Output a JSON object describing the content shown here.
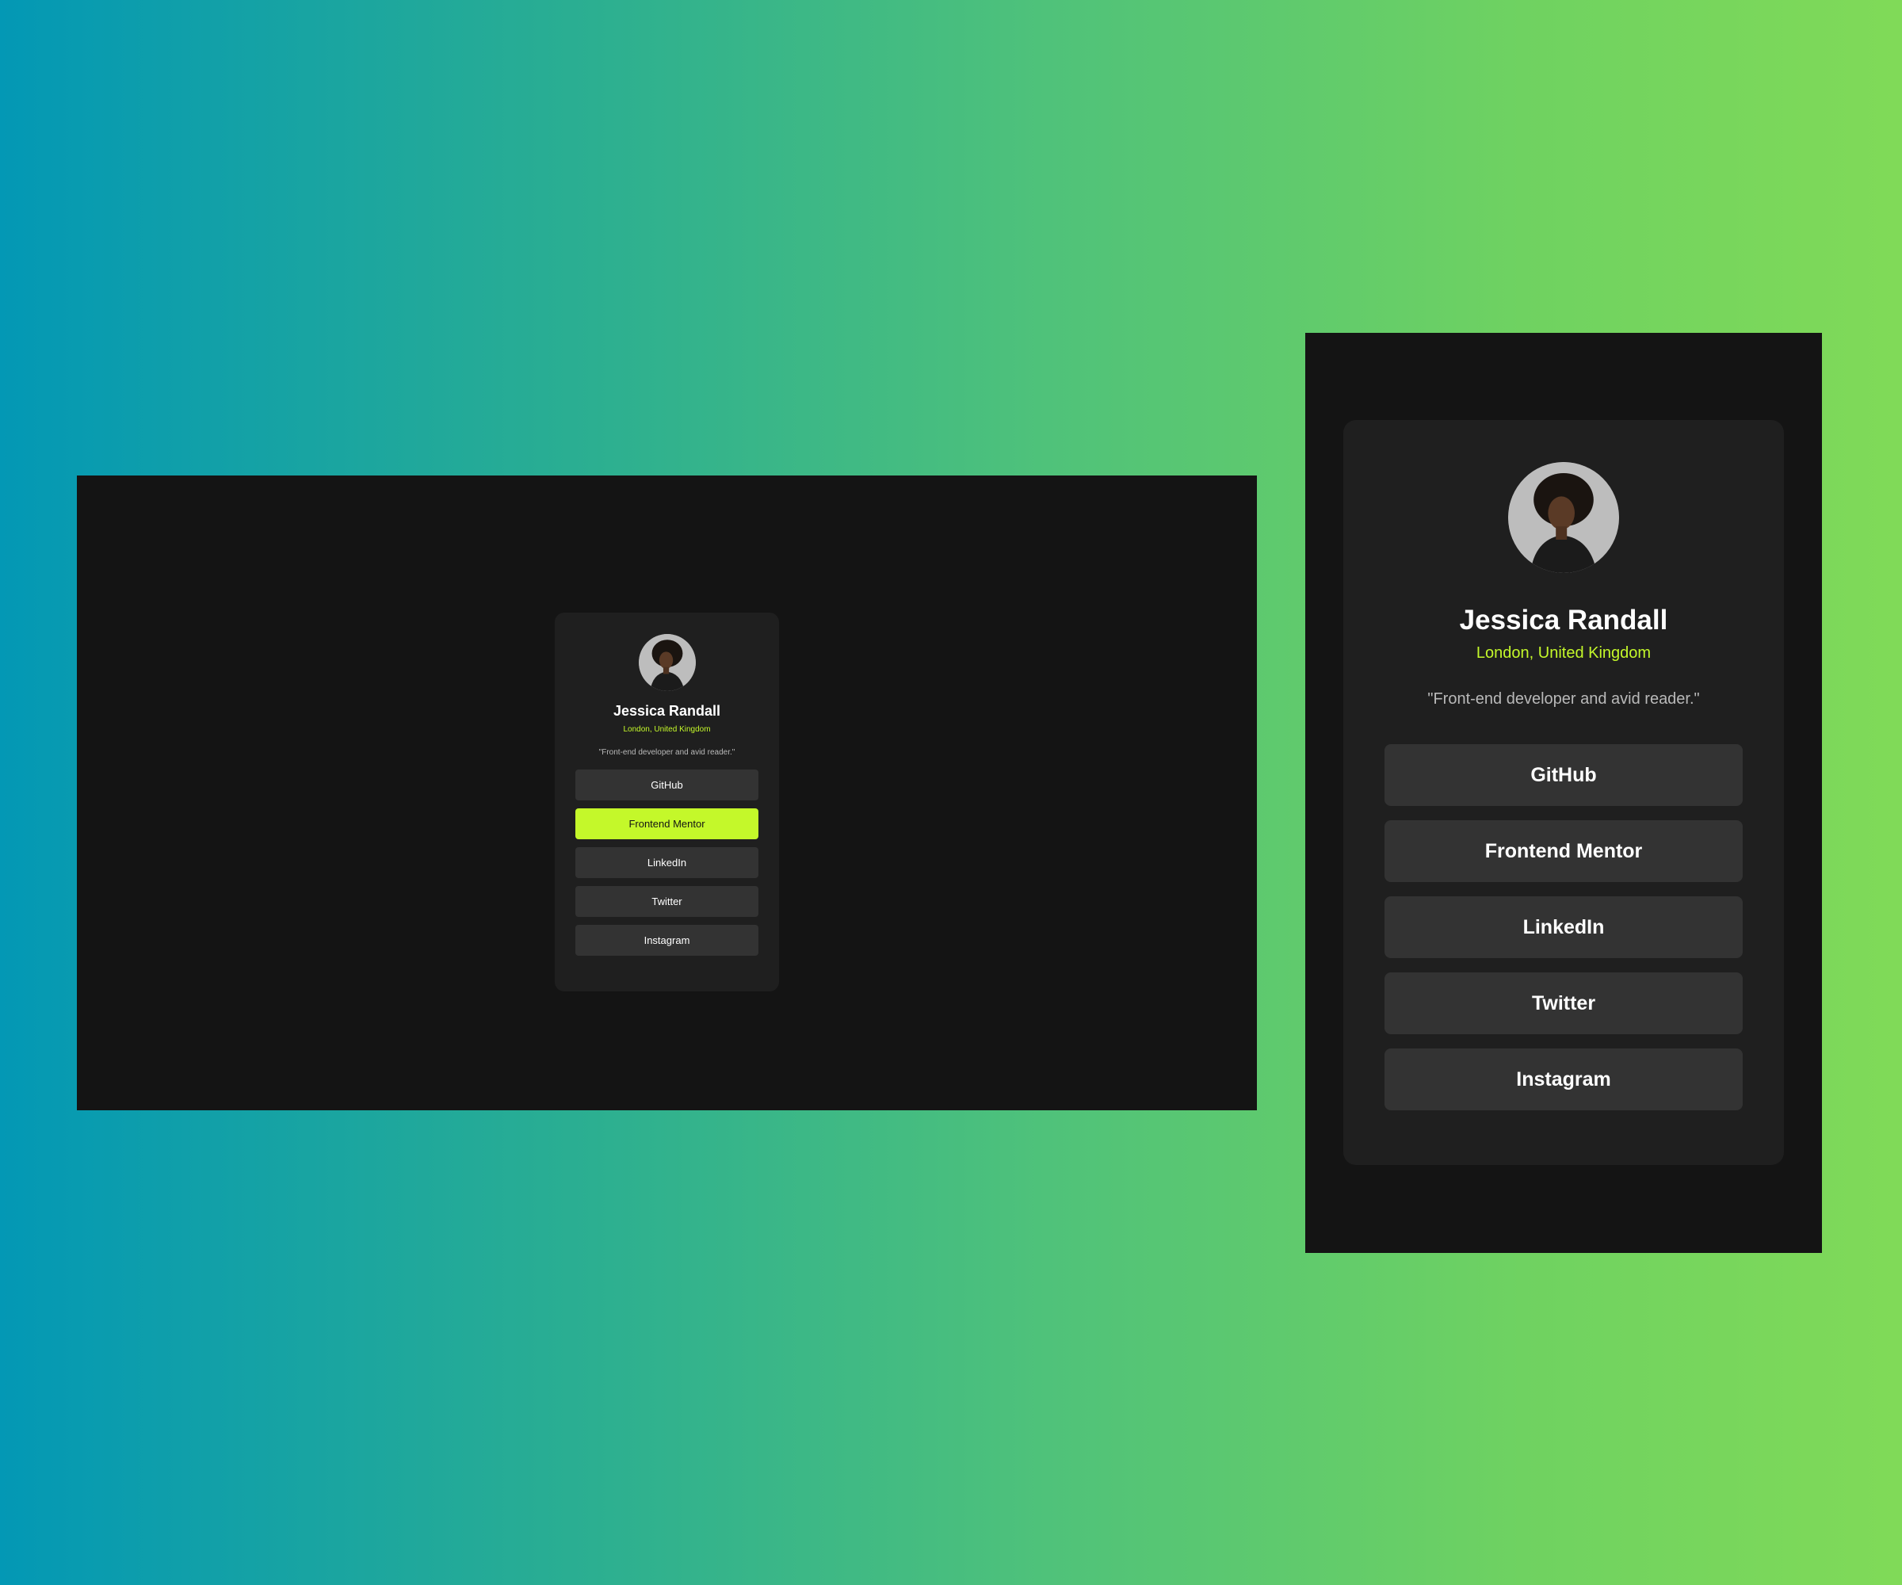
{
  "profile": {
    "name": "Jessica Randall",
    "location": "London, United Kingdom",
    "bio": "\"Front-end developer and avid reader.\"",
    "avatar_icon": "profile-photo"
  },
  "links": [
    {
      "label": "GitHub"
    },
    {
      "label": "Frontend Mentor"
    },
    {
      "label": "LinkedIn"
    },
    {
      "label": "Twitter"
    },
    {
      "label": "Instagram"
    }
  ],
  "desktop_view": {
    "hovered_link": "Frontend Mentor"
  },
  "colors": {
    "accent": "#c4f82a",
    "frame_bg": "#141414",
    "card_bg": "#1f1f1f",
    "button_bg": "#333333",
    "text_primary": "#ffffff",
    "text_muted": "#b9b9b9"
  }
}
